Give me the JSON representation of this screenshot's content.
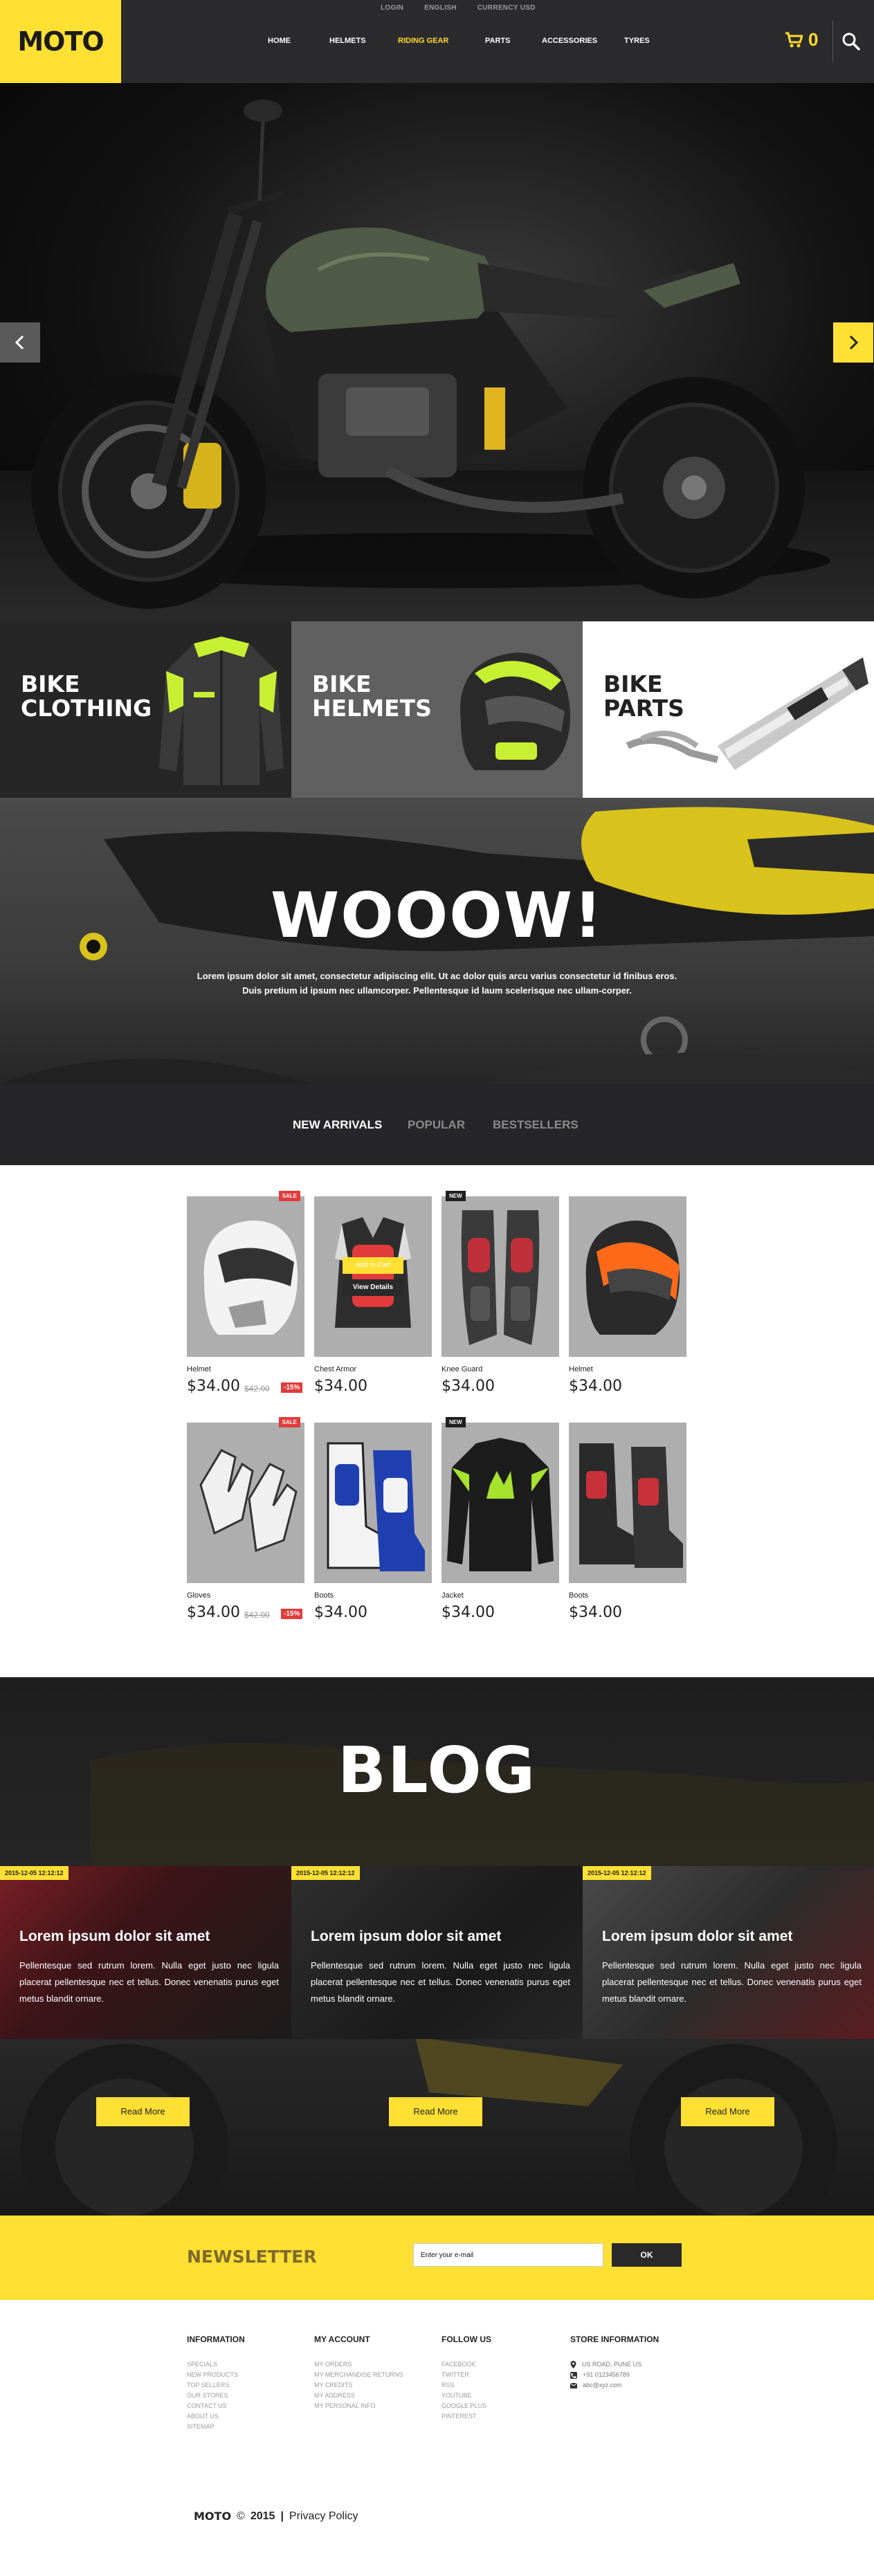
{
  "header": {
    "logo": "MOTO",
    "topbar": [
      "LOGIN",
      "ENGLISH",
      "CURRENCY USD"
    ],
    "nav": [
      {
        "label": "HOME",
        "active": false
      },
      {
        "label": "HELMETS",
        "active": false
      },
      {
        "label": "RIDING GEAR",
        "active": true
      },
      {
        "label": "PARTS",
        "active": false
      },
      {
        "label": "ACCESSORIES",
        "active": false
      },
      {
        "label": "TYRES",
        "active": false
      }
    ],
    "cart_count": "0",
    "accent": "#ffe033",
    "dark": "#2b2b2d"
  },
  "categories": [
    {
      "line1": "BIKE",
      "line2": "CLOTHING"
    },
    {
      "line1": "BIKE",
      "line2": "HELMETS"
    },
    {
      "line1": "BIKE",
      "line2": "PARTS"
    }
  ],
  "promo": {
    "title": "WOOOW!",
    "text": "Lorem ipsum dolor sit amet, consectetur adipiscing elit. Ut ac dolor quis arcu varius consectetur id finibus eros. Duis pretium id ipsum nec ullamcorper. Pellentesque id laum scelerisque nec ullam-corper."
  },
  "tabs": [
    "NEW ARRIVALS",
    "POPULAR",
    "BESTSELLERS"
  ],
  "products": [
    {
      "name": "Helmet",
      "price": "$34.00",
      "old_price": "$42.00",
      "discount": "-15%",
      "badge": "SALE"
    },
    {
      "name": "Chest Armor",
      "price": "$34.00",
      "hover_add": "Add to Cart",
      "hover_view": "View Details"
    },
    {
      "name": "Knee Guard",
      "price": "$34.00",
      "badge": "NEW"
    },
    {
      "name": "Helmet",
      "price": "$34.00"
    },
    {
      "name": "Gloves",
      "price": "$34.00",
      "old_price": "$42.00",
      "discount": "-15%",
      "badge": "SALE"
    },
    {
      "name": "Boots",
      "price": "$34.00"
    },
    {
      "name": "Jacket",
      "price": "$34.00",
      "badge": "NEW"
    },
    {
      "name": "Boots",
      "price": "$34.00"
    }
  ],
  "blog": {
    "title": "BLOG",
    "posts": [
      {
        "date": "2015-12-05 12:12:12",
        "title": "Lorem ipsum dolor sit amet",
        "text": "Pellentesque sed rutrum lorem. Nulla eget justo nec ligula placerat pellentesque nec et tellus. Donec venenatis purus eget metus blandit ornare.",
        "button": "Read More"
      },
      {
        "date": "2015-12-05 12:12:12",
        "title": "Lorem ipsum dolor sit amet",
        "text": "Pellentesque sed rutrum lorem. Nulla eget justo nec ligula placerat pellentesque nec et tellus. Donec venenatis purus eget metus blandit ornare.",
        "button": "Read More"
      },
      {
        "date": "2015-12-05 12:12:12",
        "title": "Lorem ipsum dolor sit amet",
        "text": "Pellentesque sed rutrum lorem. Nulla eget justo nec ligula placerat pellentesque nec et tellus. Donec venenatis purus eget metus blandit ornare.",
        "button": "Read More"
      }
    ]
  },
  "newsletter": {
    "title": "NEWSLETTER",
    "placeholder": "Enter your e-mail",
    "button": "OK"
  },
  "footer": {
    "information": {
      "title": "INFORMATION",
      "links": [
        "SPECIALS",
        "NEW PRODUCTS",
        "TOP SELLERS",
        "OUR STORES",
        "CONTACT US",
        "ABOUT US",
        "SITEMAP"
      ]
    },
    "account": {
      "title": "MY ACCOUNT",
      "links": [
        "MY ORDERS",
        "MY MERCHANDISE RETURNS",
        "MY CREDITS",
        "MY ADDRESS",
        "MY PERSONAL INFO"
      ]
    },
    "follow": {
      "title": "FOLLOW US",
      "links": [
        "FACEBOOK",
        "TWITTER",
        "RSS",
        "YOUTUBE",
        "GOOGLE PLUS",
        "PINTEREST"
      ]
    },
    "store": {
      "title": "STORE INFORMATION",
      "address": "US ROAD, PUNE US",
      "phone": "+91 0123456789",
      "email": "abc@xyz.com"
    },
    "brand": "MOTO",
    "year": "2015",
    "policy": "Privacy Policy"
  }
}
